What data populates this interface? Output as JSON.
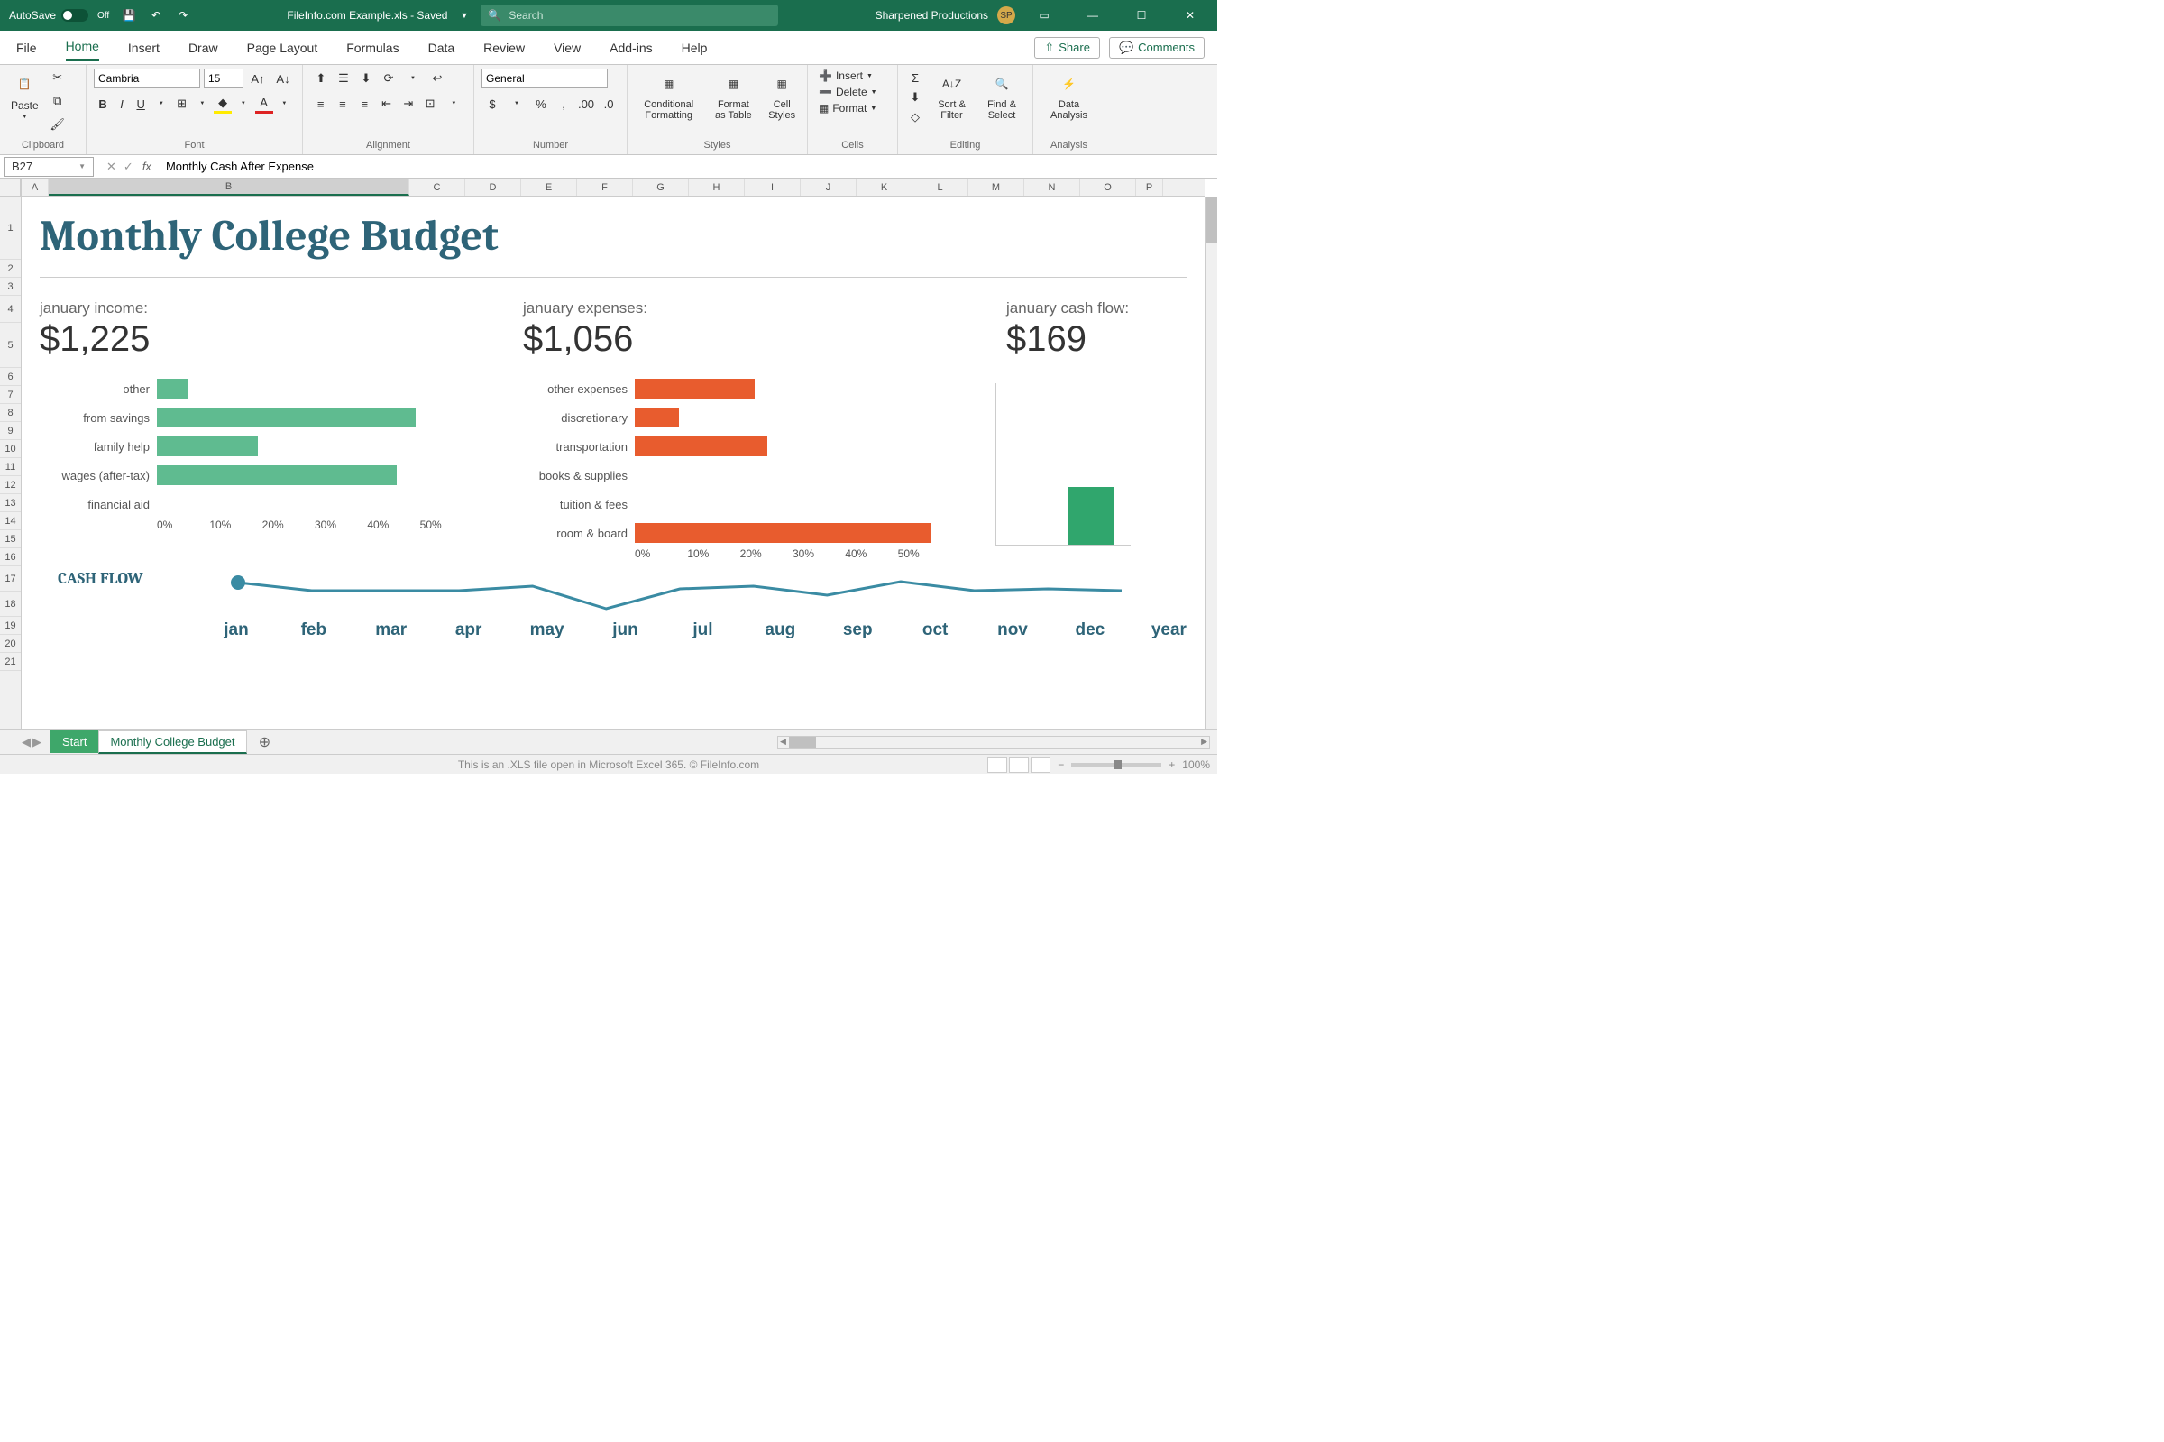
{
  "titlebar": {
    "autosave": "AutoSave",
    "autosave_state": "Off",
    "filename": "FileInfo.com Example.xls - Saved",
    "search_placeholder": "Search",
    "user_name": "Sharpened Productions",
    "user_initials": "SP"
  },
  "tabs": {
    "file": "File",
    "home": "Home",
    "insert": "Insert",
    "draw": "Draw",
    "page_layout": "Page Layout",
    "formulas": "Formulas",
    "data": "Data",
    "review": "Review",
    "view": "View",
    "addins": "Add-ins",
    "help": "Help",
    "share": "Share",
    "comments": "Comments"
  },
  "ribbon": {
    "paste": "Paste",
    "clipboard": "Clipboard",
    "font_name": "Cambria",
    "font_size": "15",
    "font_label": "Font",
    "alignment": "Alignment",
    "number_format": "General",
    "number": "Number",
    "conditional": "Conditional Formatting",
    "format_table": "Format as Table",
    "cell_styles": "Cell Styles",
    "styles": "Styles",
    "insert": "Insert",
    "delete": "Delete",
    "format": "Format",
    "cells": "Cells",
    "sort_filter": "Sort & Filter",
    "find_select": "Find & Select",
    "editing": "Editing",
    "data_analysis": "Data Analysis",
    "analysis": "Analysis"
  },
  "formula_bar": {
    "cell_ref": "B27",
    "formula": "Monthly Cash After Expense"
  },
  "columns": [
    "A",
    "B",
    "C",
    "D",
    "E",
    "F",
    "G",
    "H",
    "I",
    "J",
    "K",
    "L",
    "M",
    "N",
    "O",
    "P"
  ],
  "rows": [
    "1",
    "2",
    "3",
    "4",
    "5",
    "6",
    "7",
    "8",
    "9",
    "10",
    "11",
    "12",
    "13",
    "14",
    "15",
    "16",
    "17",
    "18",
    "19",
    "20",
    "21"
  ],
  "doc": {
    "title": "Monthly College Budget",
    "income_label": "january income:",
    "income_value": "$1,225",
    "expense_label": "january expenses:",
    "expense_value": "$1,056",
    "cashflow_label": "january cash flow:",
    "cashflow_value": "$169",
    "cashflow_heading": "CASH FLOW"
  },
  "chart_data": [
    {
      "type": "bar",
      "orientation": "horizontal",
      "title": "january income",
      "categories": [
        "other",
        "from savings",
        "family help",
        "wages (after-tax)",
        "financial aid"
      ],
      "values": [
        5,
        41,
        16,
        38,
        0
      ],
      "xlabel": "%",
      "xlim": [
        0,
        50
      ],
      "x_ticks": [
        "0%",
        "10%",
        "20%",
        "30%",
        "40%",
        "50%"
      ],
      "color": "#5fbb90"
    },
    {
      "type": "bar",
      "orientation": "horizontal",
      "title": "january expenses",
      "categories": [
        "other expenses",
        "discretionary",
        "transportation",
        "books & supplies",
        "tuition & fees",
        "room & board"
      ],
      "values": [
        19,
        7,
        21,
        0,
        0,
        47
      ],
      "xlabel": "%",
      "xlim": [
        0,
        50
      ],
      "x_ticks": [
        "0%",
        "10%",
        "20%",
        "30%",
        "40%",
        "50%"
      ],
      "color": "#e85c2e"
    },
    {
      "type": "bar",
      "title": "january cash flow (single)",
      "categories": [
        "jan"
      ],
      "values": [
        169
      ],
      "ylim": [
        0,
        500
      ],
      "color": "#30a66d"
    },
    {
      "type": "line",
      "title": "CASH FLOW",
      "x": [
        "jan",
        "feb",
        "mar",
        "apr",
        "may",
        "jun",
        "jul",
        "aug",
        "sep",
        "oct",
        "nov",
        "dec",
        "year"
      ],
      "values": [
        169,
        160,
        160,
        160,
        165,
        140,
        162,
        165,
        155,
        170,
        160,
        162,
        160
      ],
      "color": "#3a8ba3",
      "marker_index": 0
    }
  ],
  "months": [
    "jan",
    "feb",
    "mar",
    "apr",
    "may",
    "jun",
    "jul",
    "aug",
    "sep",
    "oct",
    "nov",
    "dec",
    "year"
  ],
  "sheets": {
    "start": "Start",
    "main": "Monthly College Budget"
  },
  "status": {
    "caption": "This is an .XLS file open in Microsoft Excel 365. © FileInfo.com",
    "zoom": "100%"
  }
}
